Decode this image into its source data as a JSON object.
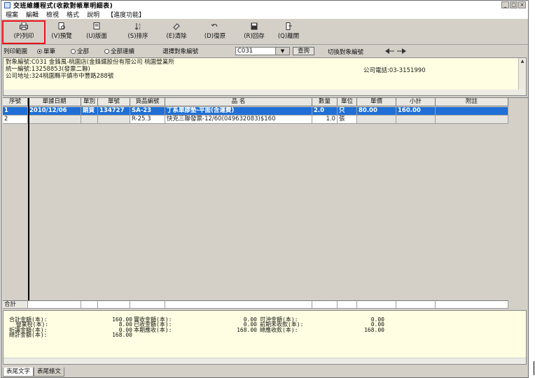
{
  "window": {
    "title": "交班維護程式(收款對帳單明細表)",
    "buttons": [
      "_",
      "□",
      "×"
    ]
  },
  "menu": [
    "檔案",
    "編輯",
    "檢視",
    "格式",
    "說明",
    "【進度功能】"
  ],
  "toolbar": [
    {
      "label": "(P)列印",
      "icon": "printer-icon"
    },
    {
      "label": "(V)預覽",
      "icon": "preview-icon"
    },
    {
      "label": "(U)版面",
      "icon": "page-setup-icon"
    },
    {
      "label": "(S)排序",
      "icon": "sort-icon"
    },
    {
      "label": "(E)清除",
      "icon": "eraser-icon"
    },
    {
      "label": "(D)復原",
      "icon": "undo-icon"
    },
    {
      "label": "(R)回存",
      "icon": "save-icon"
    },
    {
      "label": "(Q)離開",
      "icon": "exit-icon"
    }
  ],
  "range": {
    "label": "列印範圍",
    "options": [
      "單筆",
      "全部",
      "全部連續"
    ],
    "selected": 0,
    "select_label": "選擇對象編號",
    "select_value": "C031",
    "confirm": "查詢",
    "switch_label": "切換對象編號"
  },
  "info": {
    "line1": "對象編號:C031   金鋒風-桃園店(金鋒鐵股份有限公司 桃園營業所",
    "line2": "統一編號:13258853(發票二聯)",
    "line3": "公司地址:324桃園縣平鎮市中豐路288號",
    "phone": "公司電話:03-3151990"
  },
  "table": {
    "headers": [
      "序號",
      "單據日期",
      "單別",
      "單號",
      "貨品編號",
      "品          名",
      "數量",
      "單位",
      "單價",
      "小計",
      "附註"
    ],
    "rows": [
      [
        "1",
        "2010/12/06",
        "銷貨",
        "134727",
        "SA-23",
        "丁系單膠墊-平面(含運費)",
        "2.0",
        "只",
        "80.00",
        "160.00",
        ""
      ],
      [
        "2",
        "",
        "",
        "",
        "R-25.3",
        "快克三聯發票-12/60(049632083)$160",
        "1.0",
        "張",
        "",
        "",
        ""
      ]
    ],
    "sum_label": "合計"
  },
  "totals": {
    "col1": "合計金額(本):\n  營業稅(本):\n折讓金額(本):\n總計金額(本):",
    "col2": "160.00\n  8.00\n  0.00\n168.00",
    "col3": "實收金額(本):\n已收金額(本):\n本期應收(本):",
    "col4": "  0.00\n  0.00\n168.00",
    "col5": "可沖金額(本):\n前期未收款(本):\n總應收款(本):",
    "col6": "  0.00\n  0.00\n168.00"
  },
  "tabs": [
    "表尾文字",
    "表尾條文"
  ]
}
